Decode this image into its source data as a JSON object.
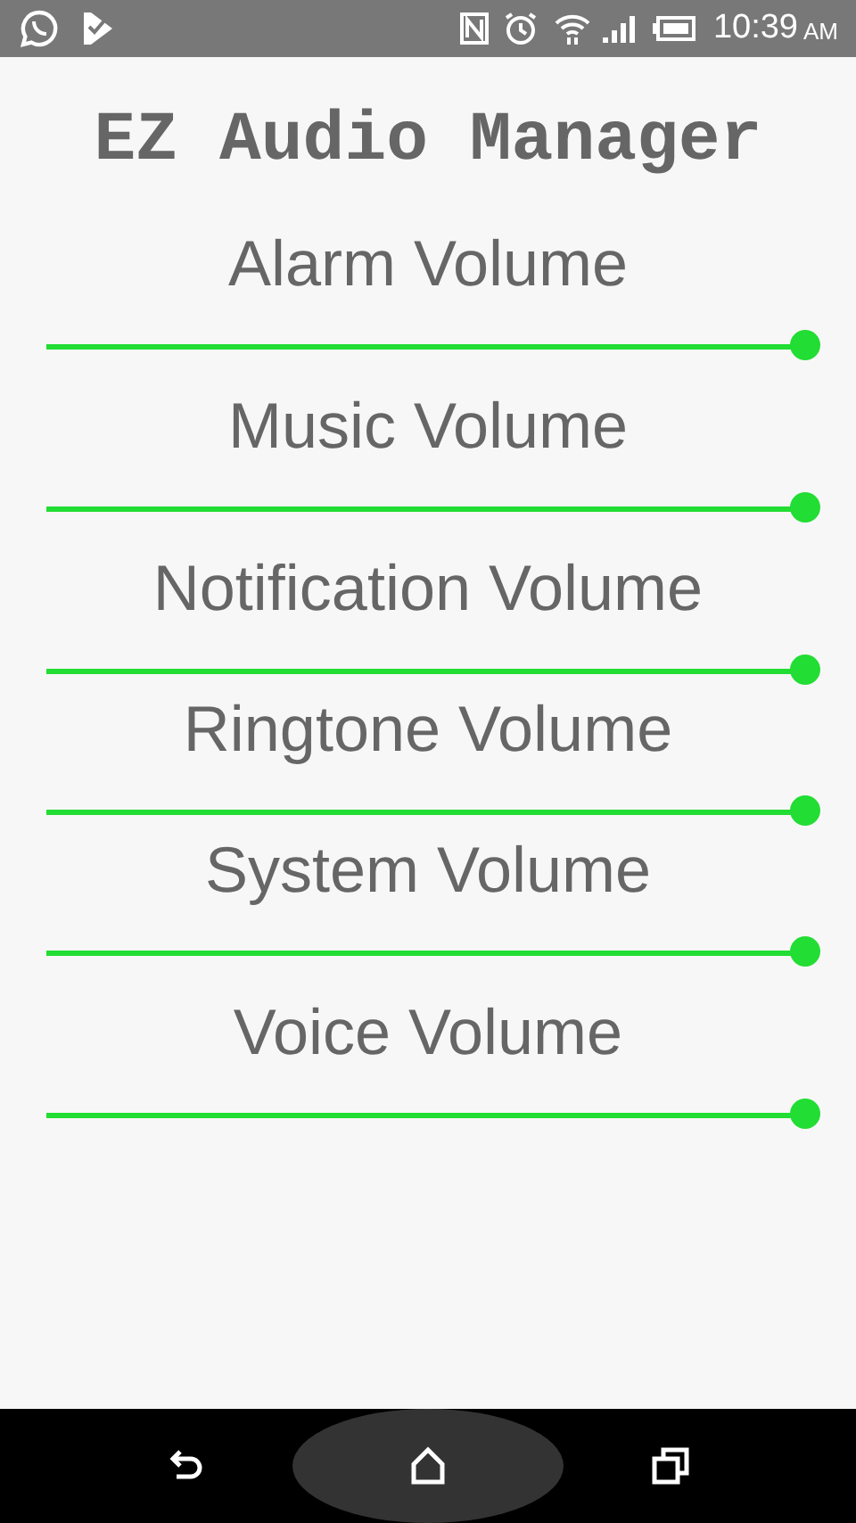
{
  "status_bar": {
    "time": "10:39",
    "meridiem": "AM"
  },
  "title": "EZ Audio Manager",
  "sliders": [
    {
      "label": "Alarm Volume",
      "level": 1
    },
    {
      "label": "Music Volume",
      "level": 1
    },
    {
      "label": "Notification Volume",
      "level": 1
    },
    {
      "label": "Ringtone Volume",
      "level": 1
    },
    {
      "label": "System Volume",
      "level": 1
    },
    {
      "label": "Voice Volume",
      "level": 1
    }
  ]
}
